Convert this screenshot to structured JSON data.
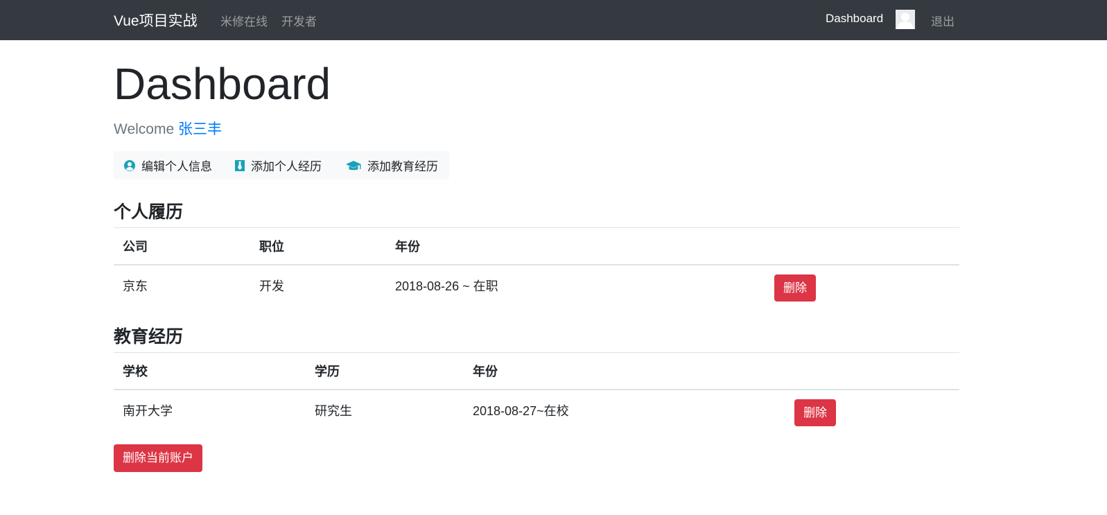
{
  "navbar": {
    "brand": "Vue项目实战",
    "links": [
      "米修在线",
      "开发者"
    ],
    "dashboard": "Dashboard",
    "logout": "退出"
  },
  "page": {
    "title": "Dashboard",
    "welcome_prefix": "Welcome",
    "user_name": "张三丰"
  },
  "actions": {
    "edit_profile": "编辑个人信息",
    "add_experience": "添加个人经历",
    "add_education": "添加教育经历"
  },
  "experience": {
    "title": "个人履历",
    "headers": [
      "公司",
      "职位",
      "年份"
    ],
    "rows": [
      {
        "company": "京东",
        "position": "开发",
        "years": "2018-08-26 ~ 在职",
        "delete": "删除"
      }
    ]
  },
  "education": {
    "title": "教育经历",
    "headers": [
      "学校",
      "学历",
      "年份"
    ],
    "rows": [
      {
        "school": "南开大学",
        "degree": "研究生",
        "years": "2018-08-27~在校",
        "delete": "删除"
      }
    ]
  },
  "delete_account": "删除当前账户",
  "colors": {
    "navbar_bg": "#343a40",
    "danger": "#dc3545",
    "link": "#007bff",
    "icon_info": "#17a2b8"
  },
  "icons": {
    "avatar": "user-avatar-icon",
    "edit_profile": "user-circle-icon",
    "add_experience": "black-tie-icon",
    "add_education": "graduation-cap-icon"
  }
}
